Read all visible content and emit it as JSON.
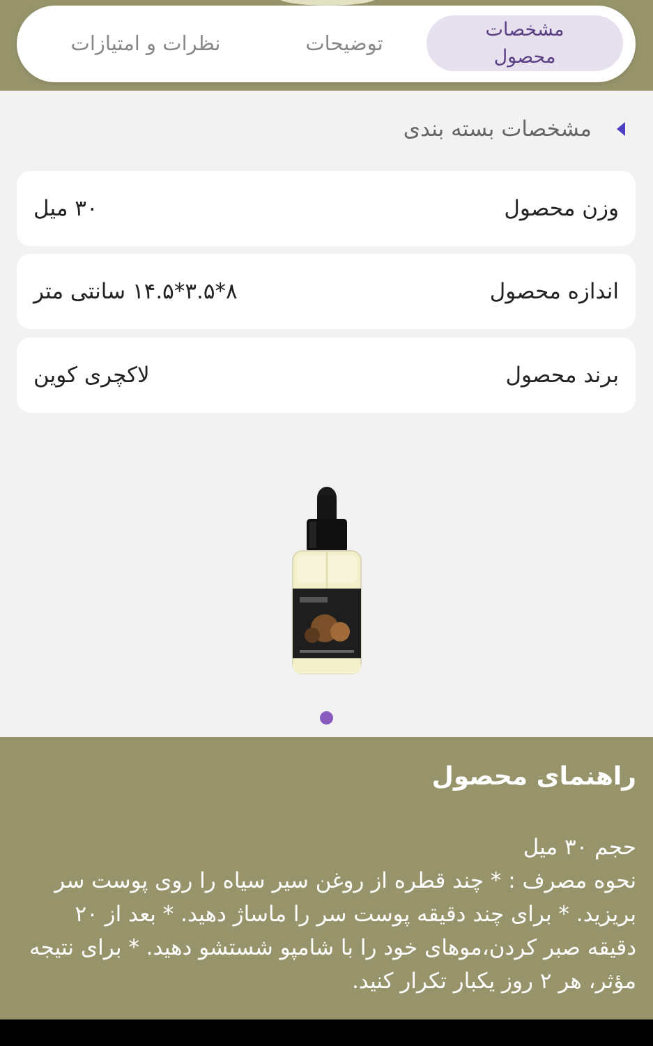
{
  "tabs": {
    "specs": "مشخصات محصول",
    "description": "توضیحات",
    "reviews": "نظرات و امتیازات"
  },
  "section": {
    "title": "مشخصات بسته بندی"
  },
  "specs": [
    {
      "label": "وزن محصول",
      "value": "۳۰ میل"
    },
    {
      "label": "اندازه محصول",
      "value": "۸*۳.۵*۱۴.۵ سانتی متر"
    },
    {
      "label": "برند محصول",
      "value": "لاکچری کوین"
    }
  ],
  "carousel": {
    "active_index": 0,
    "total": 1
  },
  "guide": {
    "title": "راهنمای محصول",
    "body": "حجم ۳۰ میل\nنحوه مصرف : * چند قطره از روغن سیر سیاه را روی پوست سر بریزید. * برای چند دقیقه پوست سر را ماساژ دهید. * بعد از ۲۰ دقیقه صبر کردن،موهای خود را با شامپو شستشو دهید. * برای نتیجه مؤثر، هر ۲ روز یکبار تکرار کنید."
  },
  "colors": {
    "olive": "#97946b",
    "active_tab_bg": "#e7e1ef",
    "active_tab_text": "#5a3f83",
    "dot": "#8a5bbf",
    "chevron": "#4b3fc3"
  }
}
